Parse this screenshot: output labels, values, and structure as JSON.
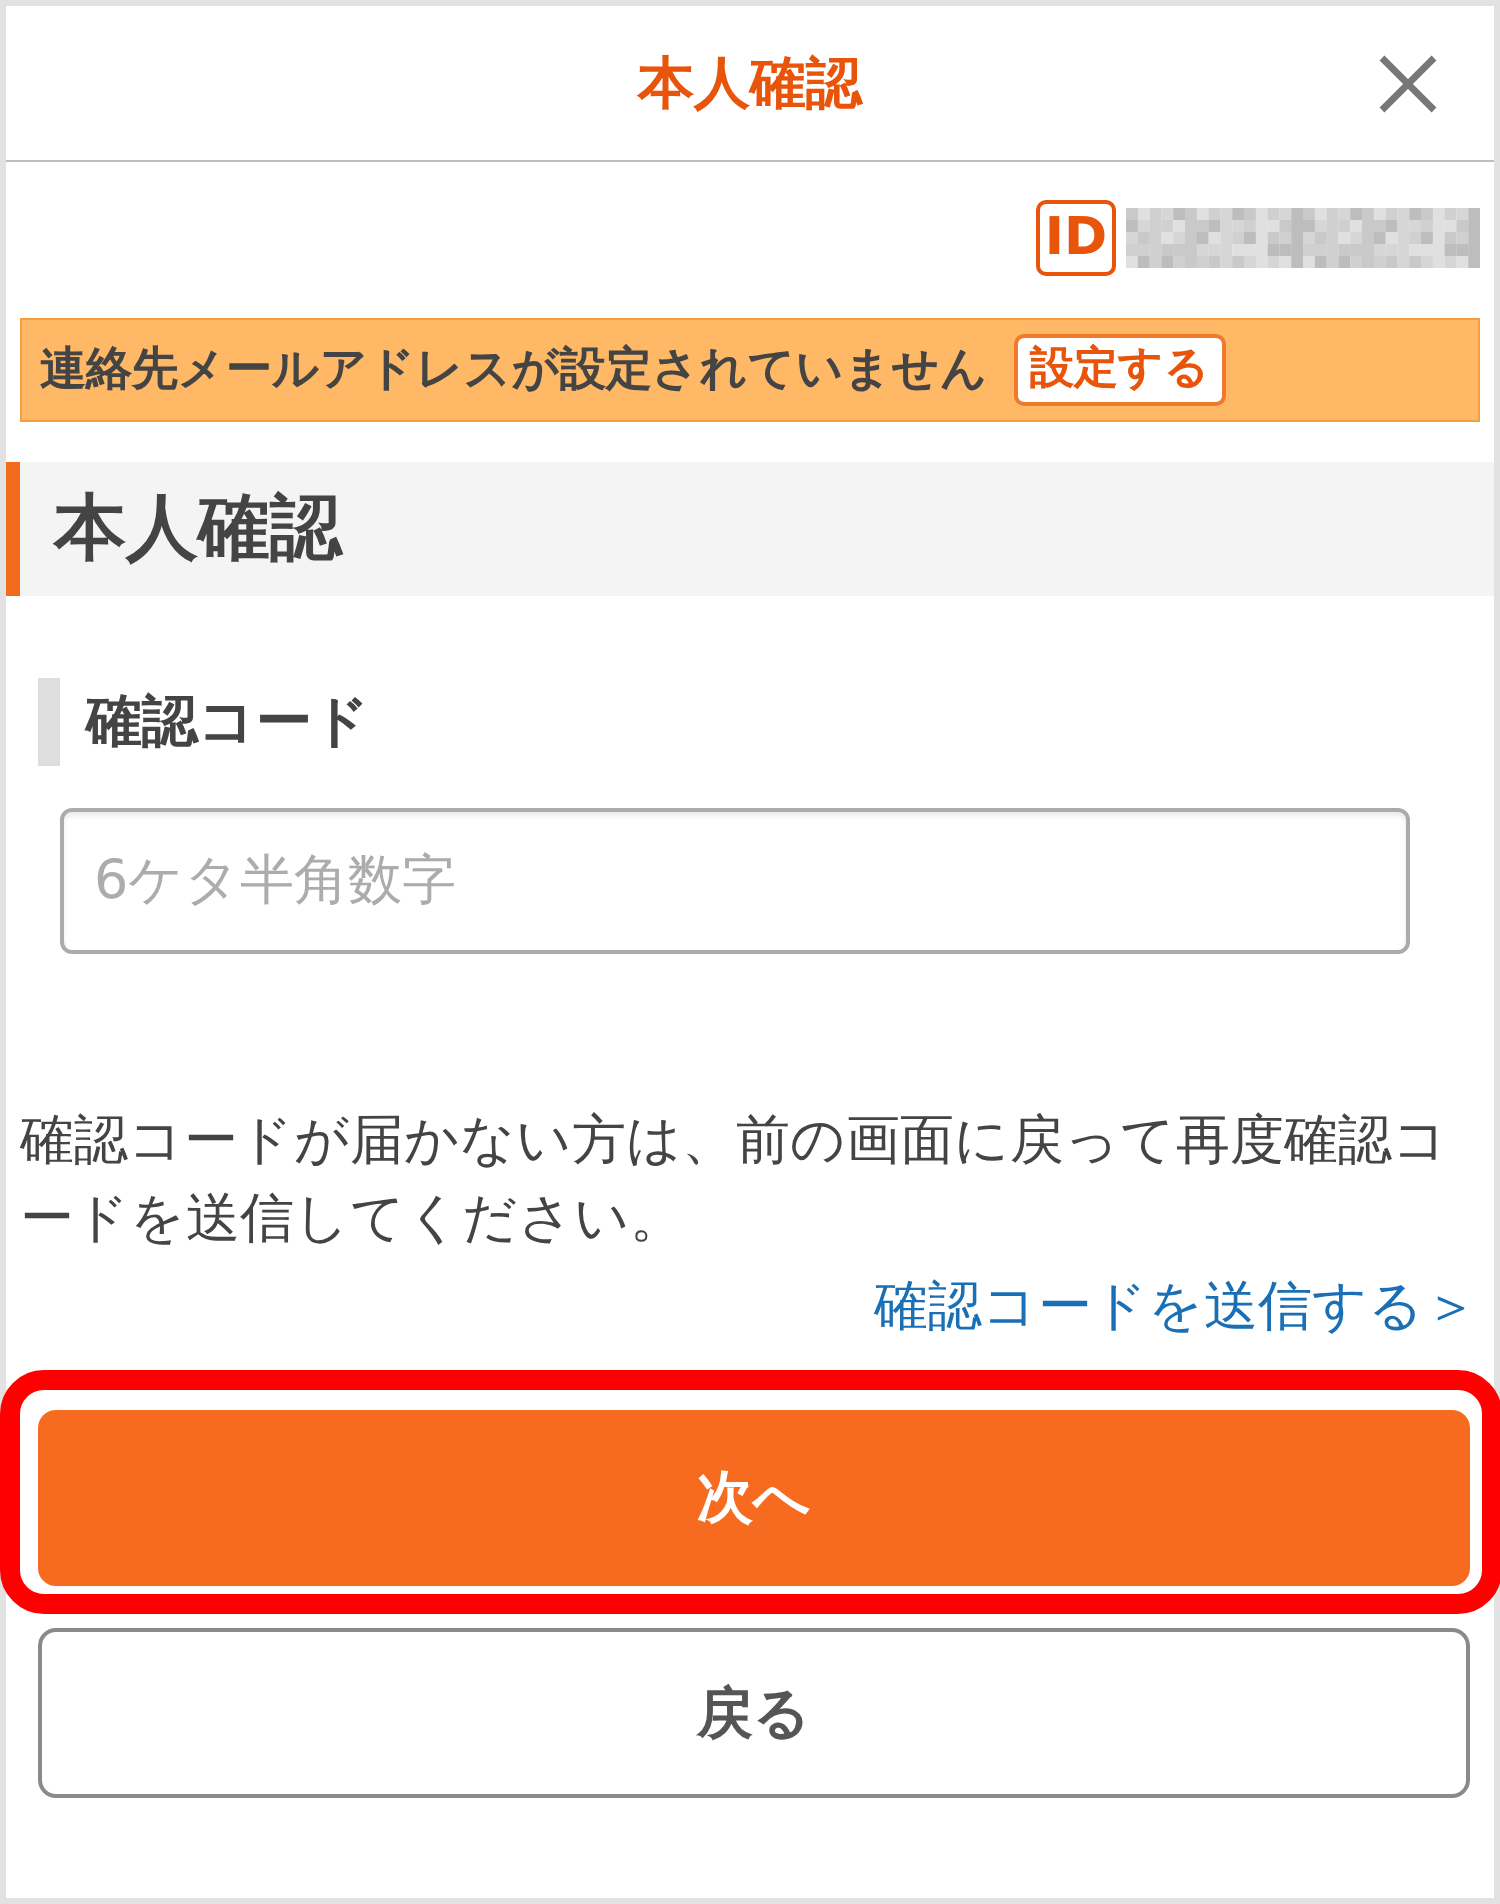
{
  "header": {
    "title": "本人確認"
  },
  "account": {
    "id_label": "ID"
  },
  "notice": {
    "message": "連絡先メールアドレスが設定されていません",
    "action": "設定する"
  },
  "section": {
    "title": "本人確認"
  },
  "code_field": {
    "label": "確認コード",
    "placeholder": "6ケタ半角数字"
  },
  "help_text": "確認コードが届かない方は、前の画面に戻って再度確認コードを送信してください。",
  "resend_link": "確認コードを送信する＞",
  "buttons": [
    {
      "label": "次へ",
      "kind": "primary",
      "highlighted": true
    },
    {
      "label": "戻る",
      "kind": "secondary",
      "highlighted": false
    }
  ]
}
